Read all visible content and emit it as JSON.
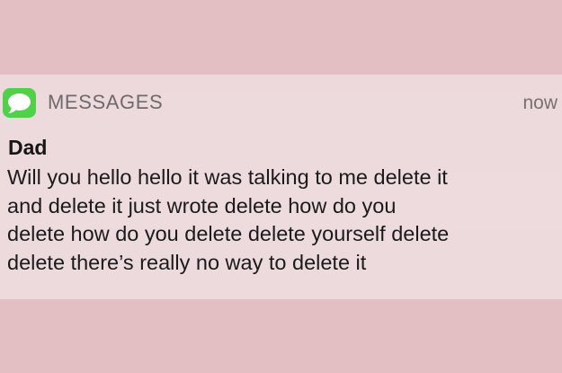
{
  "notification": {
    "app_icon": "messages-bubble-icon",
    "app_name": "MESSAGES",
    "time": "now",
    "sender": "Dad",
    "message": "Will you hello hello it was talking to me delete it\nand delete it just wrote delete how do you\ndelete how do you delete delete yourself delete\ndelete there’s really no way to delete it"
  },
  "colors": {
    "background": "#e3bec3",
    "banner": "#eddbdd",
    "icon": "#4fd24a"
  }
}
